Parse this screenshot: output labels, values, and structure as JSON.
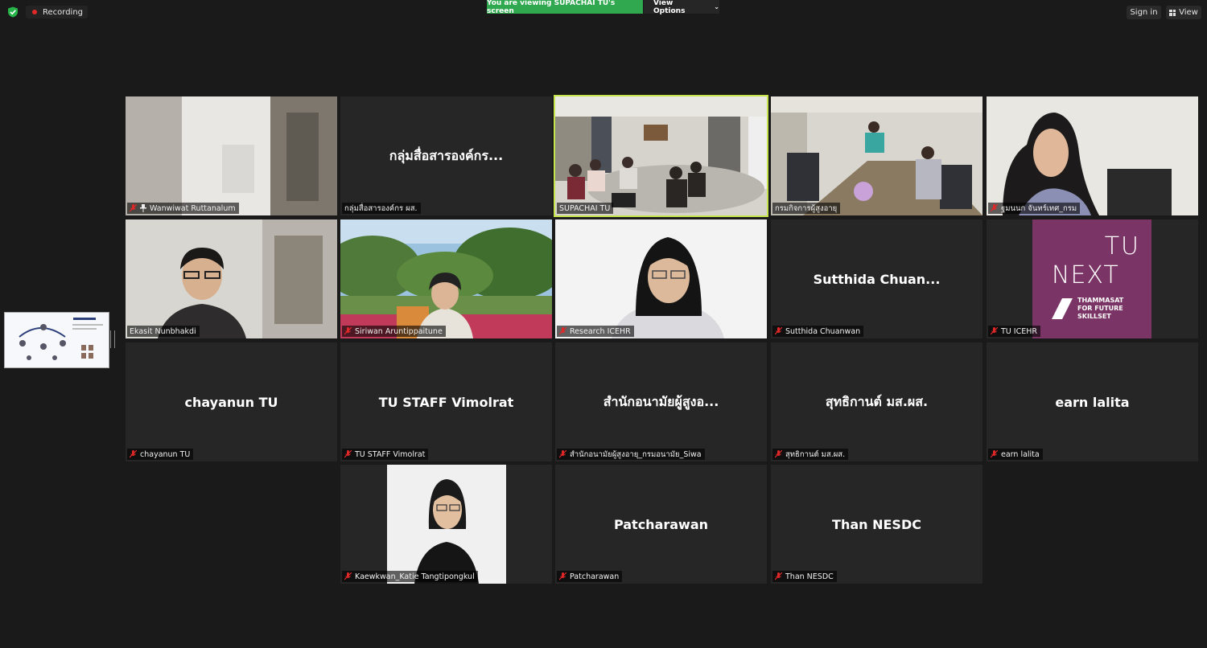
{
  "topbar": {
    "recording_label": "Recording",
    "viewing_label": "You are viewing SUPACHAI TU's screen",
    "view_options_label": "View Options",
    "sign_in_label": "Sign in",
    "view_label": "View"
  },
  "colors": {
    "viewing_banner": "#2fa84f",
    "active_speaker_border": "#c5e34a",
    "muted_icon": "#e02828",
    "tile_bg": "#262626"
  },
  "participants": [
    {
      "name": "Wanwiwat Ruttanalum",
      "display": "",
      "pinned": true
    },
    {
      "name": "กลุ่มสื่อสารองค์กร ผส.",
      "display": "กลุ่มสื่อสารองค์กร..."
    },
    {
      "name": "SUPACHAI TU",
      "display": "",
      "active": true
    },
    {
      "name": "กรมกิจการผู้สูงอายุ",
      "display": ""
    },
    {
      "name": "ฐมนนก จันทร์เทศ_กรม",
      "display": ""
    },
    {
      "name": "Ekasit Nunbhakdi",
      "display": ""
    },
    {
      "name": "Siriwan Aruntippaitune",
      "display": ""
    },
    {
      "name": "Research ICEHR",
      "display": ""
    },
    {
      "name": "Sutthida Chuanwan",
      "display": "Sutthida  Chuan..."
    },
    {
      "name": "TU ICEHR",
      "display": "",
      "logo": {
        "line1": "TU",
        "line2": "NEXT",
        "tag1": "THAMMASAT",
        "tag2": "FOR FUTURE",
        "tag3": "SKILLSET"
      }
    },
    {
      "name": "chayanun TU",
      "display": "chayanun TU"
    },
    {
      "name": "TU STAFF Vimolrat",
      "display": "TU STAFF Vimolrat"
    },
    {
      "name": "สำนักอนามัยผู้สูงอายุ_กรมอนามัย_Siwa",
      "display": "สำนักอนามัยผู้สูงอ..."
    },
    {
      "name": "สุทธิกานต์ มส.ผส.",
      "display": "สุทธิกานต์  มส.ผส."
    },
    {
      "name": "earn lalita",
      "display": "earn lalita"
    },
    {
      "name": "Kaewkwan_Katie Tangtipongkul",
      "display": ""
    },
    {
      "name": "Patcharawan",
      "display": "Patcharawan"
    },
    {
      "name": "Than NESDC",
      "display": "Than NESDC"
    }
  ]
}
